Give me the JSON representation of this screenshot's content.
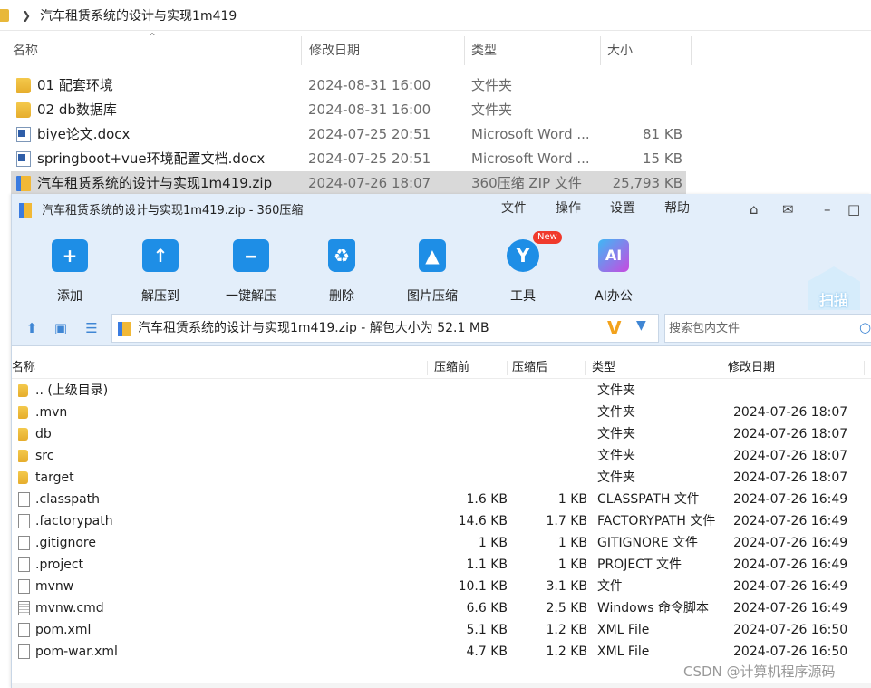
{
  "explorer": {
    "breadcrumb": "汽车租赁系统的设计与实现1m419",
    "columns": {
      "name": "名称",
      "date": "修改日期",
      "type": "类型",
      "size": "大小"
    },
    "rows": [
      {
        "name": "01 配套环境",
        "date": "2024-08-31 16:00",
        "type": "文件夹",
        "size": "",
        "icon": "folder-icon"
      },
      {
        "name": "02 db数据库",
        "date": "2024-08-31 16:00",
        "type": "文件夹",
        "size": "",
        "icon": "folder-icon"
      },
      {
        "name": "biye论文.docx",
        "date": "2024-07-25 20:51",
        "type": "Microsoft Word ...",
        "size": "81 KB",
        "icon": "word-doc-icon"
      },
      {
        "name": "springboot+vue环境配置文档.docx",
        "date": "2024-07-25 20:51",
        "type": "Microsoft Word ...",
        "size": "15 KB",
        "icon": "word-doc-icon"
      },
      {
        "name": "汽车租赁系统的设计与实现1m419.zip",
        "date": "2024-07-26 18:07",
        "type": "360压缩 ZIP 文件",
        "size": "25,793 KB",
        "icon": "zip-icon"
      }
    ]
  },
  "zip_window": {
    "title": "汽车租赁系统的设计与实现1m419.zip - 360压缩",
    "menu": [
      "文件",
      "操作",
      "设置",
      "帮助"
    ],
    "toolbar": [
      {
        "label": "添加",
        "icon": "add-folder-icon",
        "color": "#1e8ee6"
      },
      {
        "label": "解压到",
        "icon": "extract-to-icon",
        "color": "#1e8ee6"
      },
      {
        "label": "一键解压",
        "icon": "one-click-extract-icon",
        "color": "#1e8ee6"
      },
      {
        "label": "删除",
        "icon": "recycle-bin-icon",
        "color": "#1e8ee6"
      },
      {
        "label": "图片压缩",
        "icon": "image-compress-icon",
        "color": "#1e8ee6"
      },
      {
        "label": "工具",
        "icon": "tools-icon",
        "color": "#1e8ee6",
        "badge": "New"
      },
      {
        "label": "AI办公",
        "icon": "ai-office-icon",
        "color": "#c84ae0"
      }
    ],
    "scan_label": "扫描",
    "address": "汽车租赁系统的设计与实现1m419.zip - 解包大小为 52.1 MB",
    "search_placeholder": "搜索包内文件",
    "columns": {
      "name": "名称",
      "before": "压缩前",
      "after": "压缩后",
      "type": "类型",
      "date": "修改日期"
    },
    "rows": [
      {
        "name": ".. (上级目录)",
        "before": "",
        "after": "",
        "type": "文件夹",
        "date": "",
        "icon": "folder-icon"
      },
      {
        "name": ".mvn",
        "before": "",
        "after": "",
        "type": "文件夹",
        "date": "2024-07-26 18:07",
        "icon": "folder-icon"
      },
      {
        "name": "db",
        "before": "",
        "after": "",
        "type": "文件夹",
        "date": "2024-07-26 18:07",
        "icon": "folder-icon"
      },
      {
        "name": "src",
        "before": "",
        "after": "",
        "type": "文件夹",
        "date": "2024-07-26 18:07",
        "icon": "folder-icon"
      },
      {
        "name": "target",
        "before": "",
        "after": "",
        "type": "文件夹",
        "date": "2024-07-26 18:07",
        "icon": "folder-icon"
      },
      {
        "name": ".classpath",
        "before": "1.6 KB",
        "after": "1 KB",
        "type": "CLASSPATH 文件",
        "date": "2024-07-26 16:49",
        "icon": "file-icon"
      },
      {
        "name": ".factorypath",
        "before": "14.6 KB",
        "after": "1.7 KB",
        "type": "FACTORYPATH 文件",
        "date": "2024-07-26 16:49",
        "icon": "file-icon"
      },
      {
        "name": ".gitignore",
        "before": "1 KB",
        "after": "1 KB",
        "type": "GITIGNORE 文件",
        "date": "2024-07-26 16:49",
        "icon": "file-icon"
      },
      {
        "name": ".project",
        "before": "1.1 KB",
        "after": "1 KB",
        "type": "PROJECT 文件",
        "date": "2024-07-26 16:49",
        "icon": "file-icon"
      },
      {
        "name": "mvnw",
        "before": "10.1 KB",
        "after": "3.1 KB",
        "type": "文件",
        "date": "2024-07-26 16:49",
        "icon": "file-icon"
      },
      {
        "name": "mvnw.cmd",
        "before": "6.6 KB",
        "after": "2.5 KB",
        "type": "Windows 命令脚本",
        "date": "2024-07-26 16:49",
        "icon": "cmd-script-icon"
      },
      {
        "name": "pom.xml",
        "before": "5.1 KB",
        "after": "1.2 KB",
        "type": "XML File",
        "date": "2024-07-26 16:50",
        "icon": "file-icon"
      },
      {
        "name": "pom-war.xml",
        "before": "4.7 KB",
        "after": "1.2 KB",
        "type": "XML File",
        "date": "2024-07-26 16:50",
        "icon": "file-icon"
      }
    ]
  },
  "watermark": "CSDN @计算机程序源码"
}
